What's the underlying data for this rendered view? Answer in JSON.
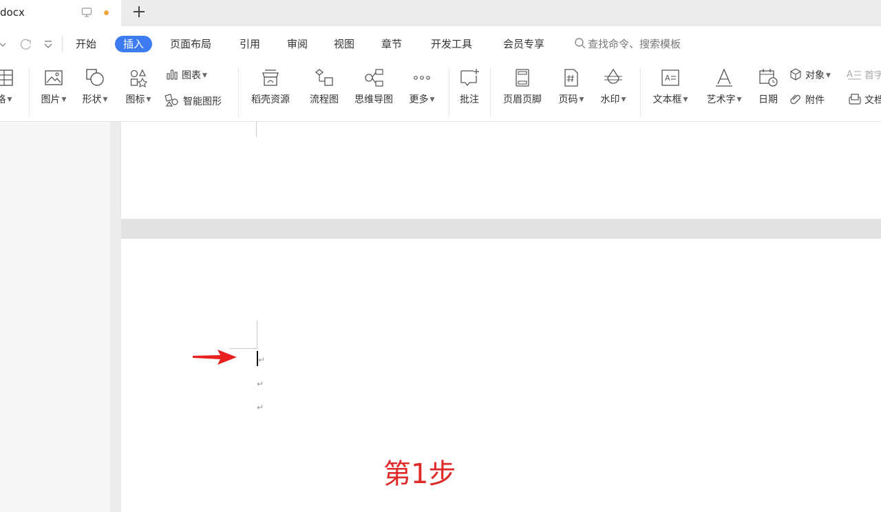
{
  "tab": {
    "title": "docx"
  },
  "menu": {
    "items": [
      "开始",
      "插入",
      "页面布局",
      "引用",
      "审阅",
      "视图",
      "章节",
      "开发工具",
      "会员专享"
    ],
    "active": "插入",
    "search_placeholder": "查找命令、搜索模板"
  },
  "ribbon": {
    "table": "格",
    "picture": "图片",
    "shape": "形状",
    "icon": "图标",
    "chart": "图表",
    "smart_art": "智能图形",
    "daoke": "稻壳资源",
    "flowchart": "流程图",
    "mindmap": "思维导图",
    "more": "更多",
    "comment": "批注",
    "header_footer": "页眉页脚",
    "page_number": "页码",
    "watermark": "水印",
    "textbox": "文本框",
    "wordart": "艺术字",
    "date": "日期",
    "object": "对象",
    "attachment": "附件",
    "first_letter": "首字",
    "doc_part": "文档"
  },
  "document": {
    "para_mark": "↵",
    "annotation": "第1步"
  },
  "colors": {
    "accent": "#3c7bf2",
    "annotation": "#e02a2a",
    "unsaved_dot": "#f3a73b"
  }
}
